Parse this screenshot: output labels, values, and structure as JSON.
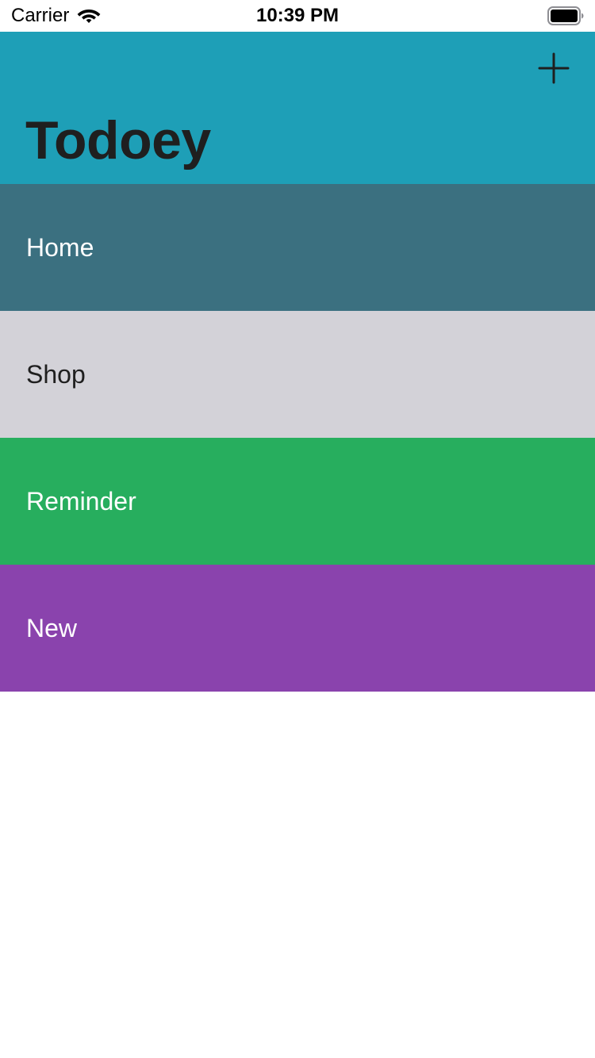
{
  "status_bar": {
    "carrier": "Carrier",
    "time": "10:39 PM",
    "icons": [
      "wifi-icon",
      "battery-icon"
    ]
  },
  "nav": {
    "title": "Todoey",
    "add_icon": "plus-icon",
    "background": "#1e9fb7",
    "title_color": "#1f1f1f"
  },
  "categories": [
    {
      "label": "Home",
      "background": "#3b7080",
      "text_color": "#ffffff"
    },
    {
      "label": "Shop",
      "background": "#d3d2d8",
      "text_color": "#1f1f1f"
    },
    {
      "label": "Reminder",
      "background": "#27ae5e",
      "text_color": "#ffffff"
    },
    {
      "label": "New",
      "background": "#8a43ad",
      "text_color": "#ffffff"
    }
  ]
}
